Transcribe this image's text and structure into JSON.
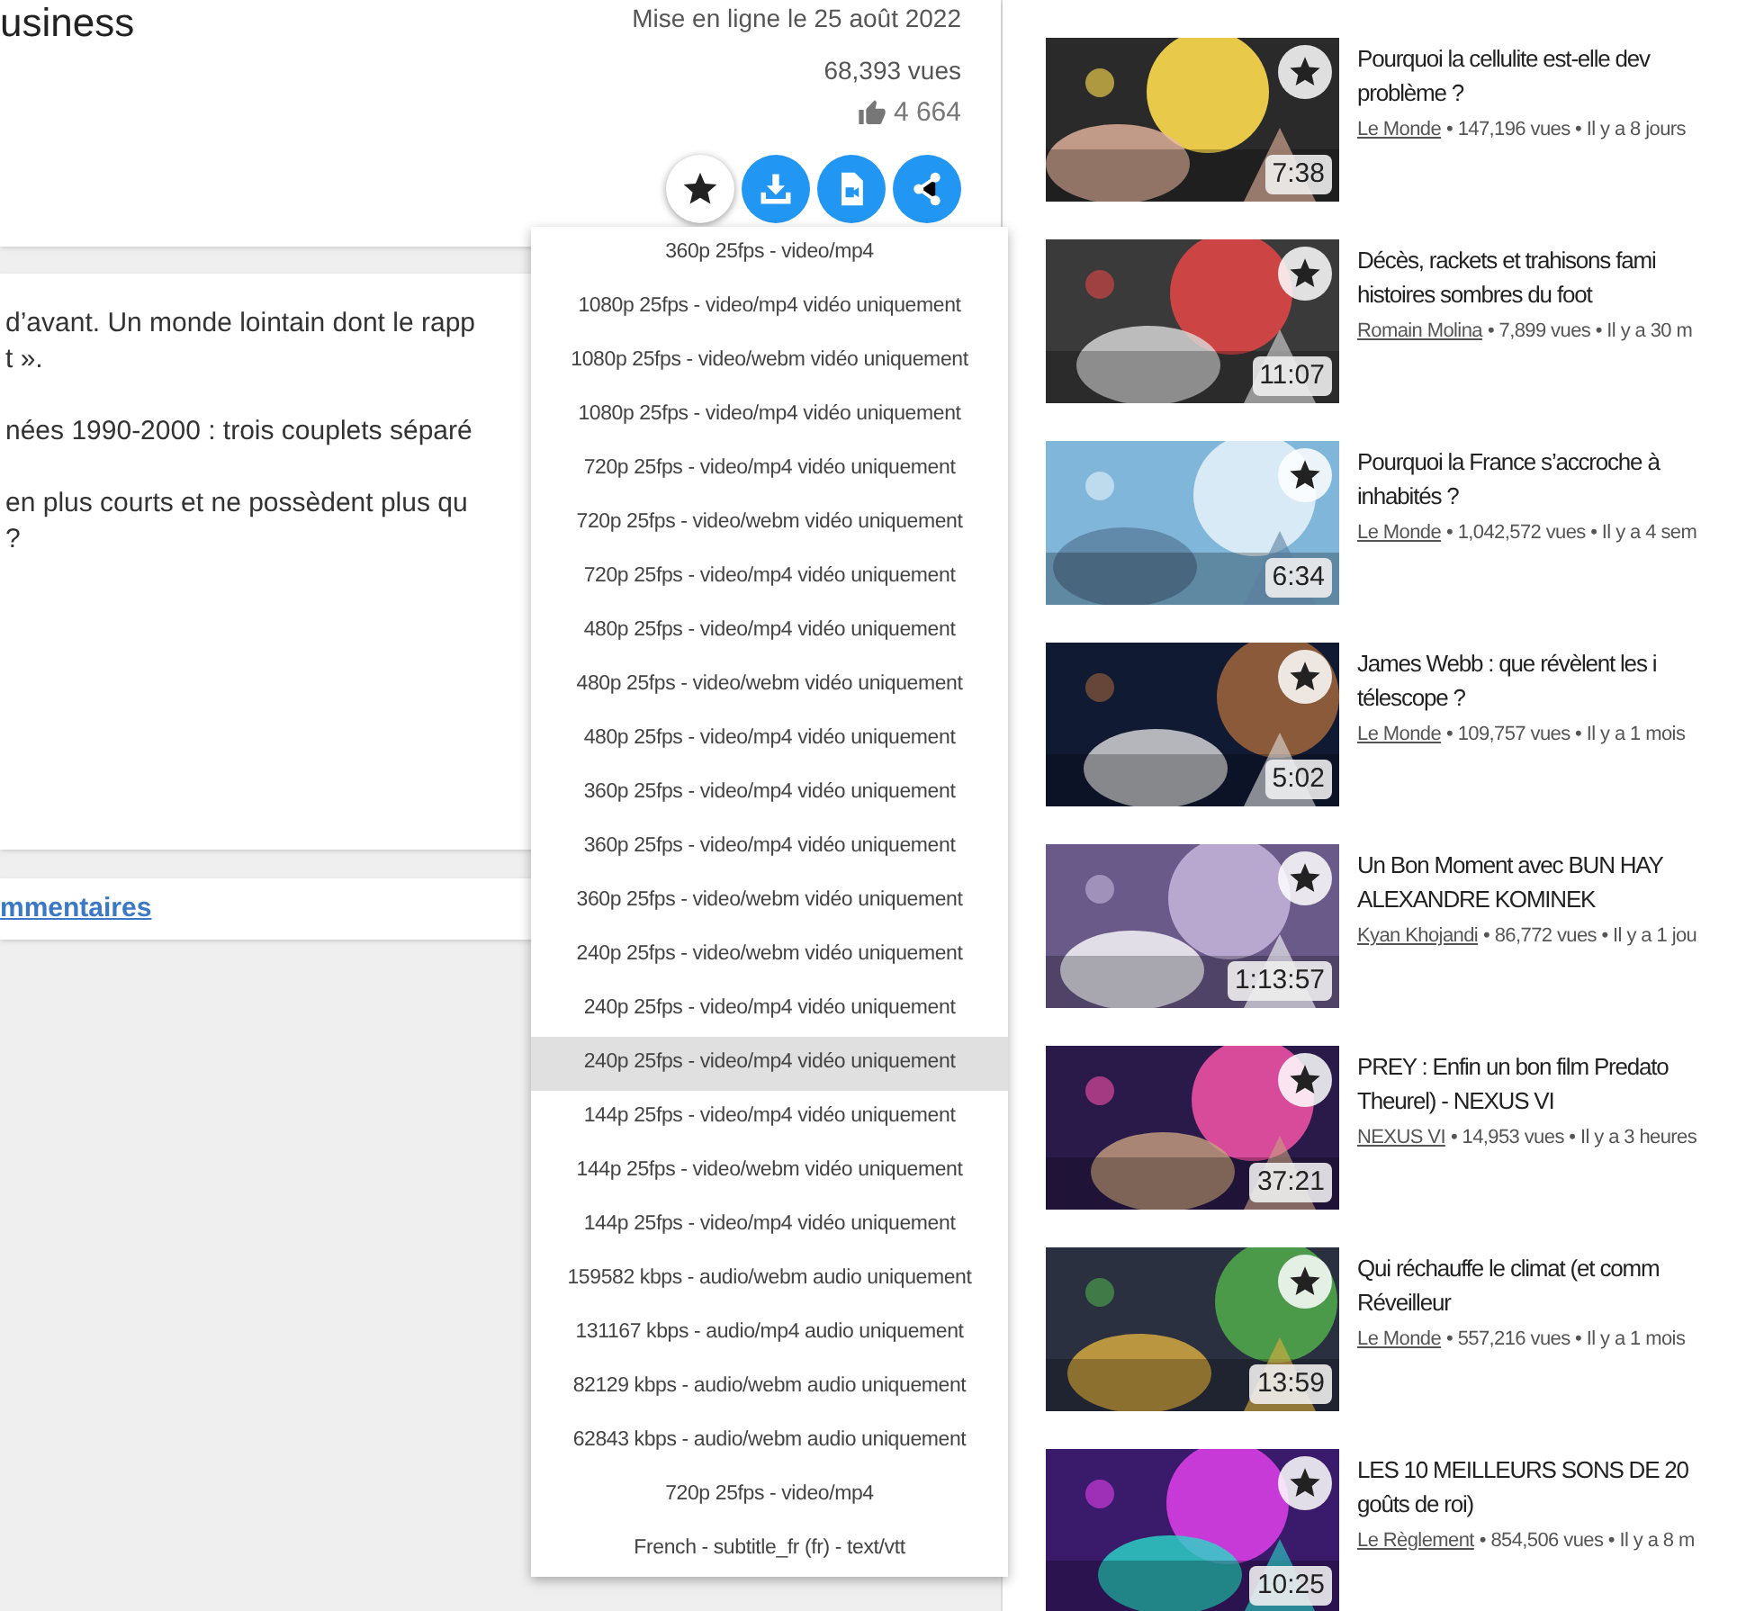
{
  "header": {
    "title": "usiness",
    "published": "Mise en ligne le 25 août 2022",
    "views": "68,393 vues",
    "likes": "4 664"
  },
  "actions": [
    {
      "kind": "star"
    },
    {
      "kind": "download"
    },
    {
      "kind": "video-file"
    },
    {
      "kind": "share"
    }
  ],
  "description": {
    "paragraphs": [
      [
        "d’avant. Un monde lointain dont le rapp",
        "t »."
      ],
      [
        "nées 1990-2000 : trois couplets séparé"
      ],
      [
        "en plus courts et ne possèdent plus qu",
        "?"
      ]
    ]
  },
  "comments_link": "mmentaires",
  "format_menu": [
    {
      "label": "360p 25fps - video/mp4",
      "selected": false
    },
    {
      "label": "1080p 25fps - video/mp4 vidéo uniquement",
      "selected": false
    },
    {
      "label": "1080p 25fps - video/webm vidéo uniquement",
      "selected": false
    },
    {
      "label": "1080p 25fps - video/mp4 vidéo uniquement",
      "selected": false
    },
    {
      "label": "720p 25fps - video/mp4 vidéo uniquement",
      "selected": false
    },
    {
      "label": "720p 25fps - video/webm vidéo uniquement",
      "selected": false
    },
    {
      "label": "720p 25fps - video/mp4 vidéo uniquement",
      "selected": false
    },
    {
      "label": "480p 25fps - video/mp4 vidéo uniquement",
      "selected": false
    },
    {
      "label": "480p 25fps - video/webm vidéo uniquement",
      "selected": false
    },
    {
      "label": "480p 25fps - video/mp4 vidéo uniquement",
      "selected": false
    },
    {
      "label": "360p 25fps - video/mp4 vidéo uniquement",
      "selected": false
    },
    {
      "label": "360p 25fps - video/mp4 vidéo uniquement",
      "selected": false
    },
    {
      "label": "360p 25fps - video/webm vidéo uniquement",
      "selected": false
    },
    {
      "label": "240p 25fps - video/webm vidéo uniquement",
      "selected": false
    },
    {
      "label": "240p 25fps - video/mp4 vidéo uniquement",
      "selected": false
    },
    {
      "label": "240p 25fps - video/mp4 vidéo uniquement",
      "selected": true
    },
    {
      "label": "144p 25fps - video/mp4 vidéo uniquement",
      "selected": false
    },
    {
      "label": "144p 25fps - video/webm vidéo uniquement",
      "selected": false
    },
    {
      "label": "144p 25fps - video/mp4 vidéo uniquement",
      "selected": false
    },
    {
      "label": "159582 kbps - audio/webm audio uniquement",
      "selected": false
    },
    {
      "label": "131167 kbps - audio/mp4 audio uniquement",
      "selected": false
    },
    {
      "label": "82129 kbps - audio/webm audio uniquement",
      "selected": false
    },
    {
      "label": "62843 kbps - audio/webm audio uniquement",
      "selected": false
    },
    {
      "label": "720p 25fps - video/mp4",
      "selected": false
    },
    {
      "label": "French - subtitle_fr (fr) - text/vtt",
      "selected": false
    }
  ],
  "related_videos": [
    {
      "title_lines": [
        "Pourquoi la cellulite est-elle dev",
        "problème ?"
      ],
      "channel": "Le Monde",
      "details": "• 147,196 vues • Il y a 8 jours",
      "duration": "7:38",
      "thumb": {
        "kind": "picture"
      }
    },
    {
      "title_lines": [
        "Décès, rackets et trahisons fami",
        "histoires sombres du foot"
      ],
      "channel": "Romain Molina",
      "details": "• 7,899 vues • Il y a 30 m",
      "duration": "11:07",
      "thumb": {
        "kind": "picture"
      }
    },
    {
      "title_lines": [
        "Pourquoi la France s’accroche à",
        "inhabités ?"
      ],
      "channel": "Le Monde",
      "details": "• 1,042,572 vues • Il y a 4 sem",
      "duration": "6:34",
      "thumb": {
        "kind": "picture"
      }
    },
    {
      "title_lines": [
        "James Webb : que révèlent les i",
        "télescope ?"
      ],
      "channel": "Le Monde",
      "details": "• 109,757 vues • Il y a 1 mois",
      "duration": "5:02",
      "thumb": {
        "kind": "picture"
      }
    },
    {
      "title_lines": [
        "Un Bon Moment avec BUN HAY",
        "ALEXANDRE KOMINEK"
      ],
      "channel": "Kyan Khojandi",
      "details": "• 86,772 vues • Il y a 1 jou",
      "duration": "1:13:57",
      "thumb": {
        "kind": "picture"
      }
    },
    {
      "title_lines": [
        "PREY : Enfin un bon film Predato",
        "Theurel) - NEXUS VI"
      ],
      "channel": "NEXUS VI",
      "details": "• 14,953 vues • Il y a 3 heures",
      "duration": "37:21",
      "thumb": {
        "kind": "picture"
      }
    },
    {
      "title_lines": [
        "Qui réchauffe le climat (et comm",
        "Réveilleur"
      ],
      "channel": "Le Monde",
      "details": "• 557,216 vues • Il y a 1 mois",
      "duration": "13:59",
      "thumb": {
        "kind": "picture"
      }
    },
    {
      "title_lines": [
        "LES 10 MEILLEURS SONS DE 20",
        "goûts de roi)"
      ],
      "channel": "Le Règlement",
      "details": "• 854,506 vues • Il y a 8 m",
      "duration": "10:25",
      "thumb": {
        "kind": "picture"
      }
    }
  ]
}
